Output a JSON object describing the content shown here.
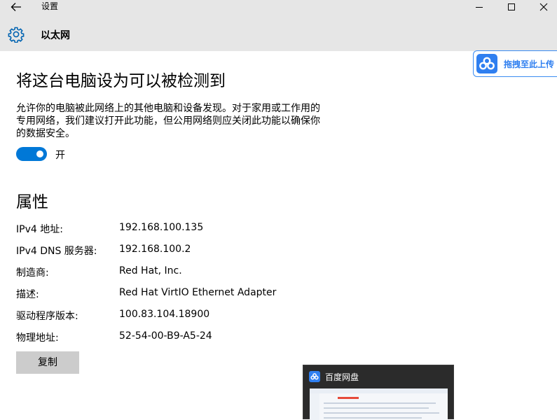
{
  "window": {
    "title": "设置"
  },
  "header": {
    "title": "以太网"
  },
  "discovery": {
    "heading": "将这台电脑设为可以被检测到",
    "description": "允许你的电脑被此网络上的其他电脑和设备发现。对于家用或工作用的专用网络，我们建议打开此功能，但公用网络则应关闭此功能以确保你的数据安全。",
    "toggle_state": "开",
    "toggle_on": true
  },
  "properties": {
    "heading": "属性",
    "rows": [
      {
        "label": "IPv4 地址:",
        "value": "192.168.100.135"
      },
      {
        "label": "IPv4 DNS 服务器:",
        "value": "192.168.100.2"
      },
      {
        "label": "制造商:",
        "value": "Red Hat, Inc."
      },
      {
        "label": "描述:",
        "value": "Red Hat VirtIO Ethernet Adapter"
      },
      {
        "label": "驱动程序版本:",
        "value": "100.83.104.18900"
      },
      {
        "label": "物理地址:",
        "value": "52-54-00-B9-A5-24"
      }
    ],
    "copy_label": "复制"
  },
  "baidu_float": {
    "text": "拖拽至此上传"
  },
  "taskbar_thumbnail": {
    "title": "百度网盘"
  },
  "colors": {
    "accent": "#0078d7",
    "titlebar": "#e6e6e6",
    "baidu_blue": "#2f7ff0",
    "button_gray": "#cccccc"
  },
  "icons": {
    "back": "back-arrow-icon",
    "settings": "gear-icon",
    "baidu": "baidu-netdisk-cloud-icon"
  }
}
